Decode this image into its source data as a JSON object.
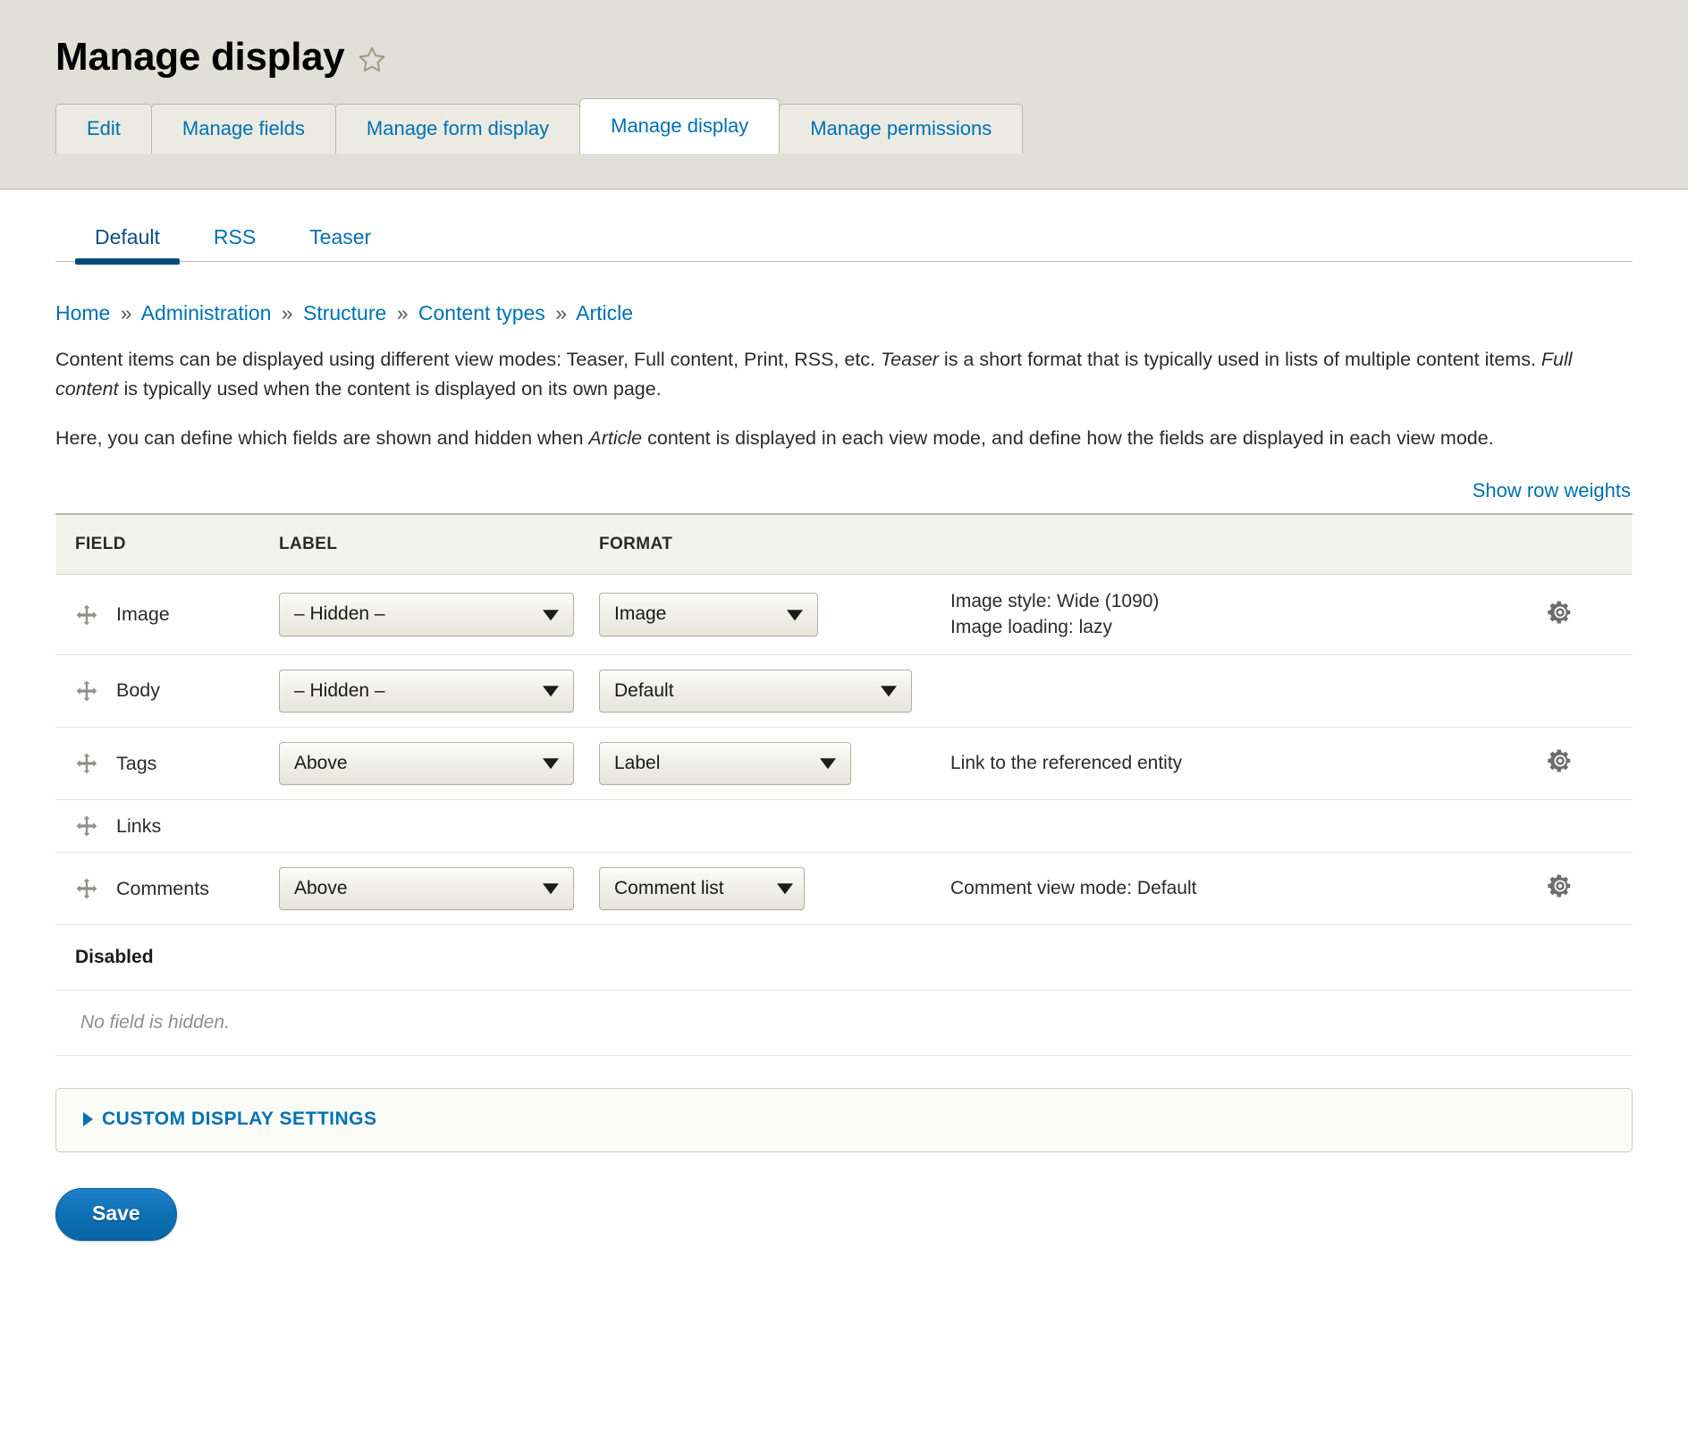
{
  "header": {
    "title": "Manage display",
    "star_icon": "star-outline-icon"
  },
  "primary_tabs": [
    {
      "label": "Edit",
      "active": false
    },
    {
      "label": "Manage fields",
      "active": false
    },
    {
      "label": "Manage form display",
      "active": false
    },
    {
      "label": "Manage display",
      "active": true
    },
    {
      "label": "Manage permissions",
      "active": false
    }
  ],
  "secondary_tabs": [
    {
      "label": "Default",
      "active": true
    },
    {
      "label": "RSS",
      "active": false
    },
    {
      "label": "Teaser",
      "active": false
    }
  ],
  "breadcrumb": {
    "separator": "»",
    "items": [
      "Home",
      "Administration",
      "Structure",
      "Content types",
      "Article"
    ]
  },
  "description": {
    "paragraph1_part1": "Content items can be displayed using different view modes: Teaser, Full content, Print, RSS, etc. ",
    "paragraph1_em1": "Teaser",
    "paragraph1_part2": " is a short format that is typically used in lists of multiple content items. ",
    "paragraph1_em2": "Full content",
    "paragraph1_part3": " is typically used when the content is displayed on its own page.",
    "paragraph2_part1": "Here, you can define which fields are shown and hidden when ",
    "paragraph2_em1": "Article",
    "paragraph2_part2": " content is displayed in each view mode, and define how the fields are displayed in each view mode."
  },
  "row_weights_link": "Show row weights",
  "table": {
    "headers": {
      "field": "FIELD",
      "label": "LABEL",
      "format": "FORMAT",
      "summary": "",
      "operations": ""
    },
    "rows": [
      {
        "field": "Image",
        "label_select": "– Hidden –",
        "format_select": "Image",
        "summary_lines": [
          "Image style: Wide (1090)",
          "Image loading: lazy"
        ],
        "has_settings": true
      },
      {
        "field": "Body",
        "label_select": "– Hidden –",
        "format_select": "Default",
        "summary_lines": [],
        "has_settings": false
      },
      {
        "field": "Tags",
        "label_select": "Above",
        "format_select": "Label",
        "summary_lines": [
          "Link to the referenced entity"
        ],
        "has_settings": true
      },
      {
        "field": "Links",
        "label_select": null,
        "format_select": null,
        "summary_lines": [],
        "has_settings": false
      },
      {
        "field": "Comments",
        "label_select": "Above",
        "format_select": "Comment list",
        "summary_lines": [
          "Comment view mode: Default"
        ],
        "has_settings": true
      }
    ],
    "disabled_region_label": "Disabled",
    "disabled_empty_message": "No field is hidden."
  },
  "custom_display_settings": {
    "summary_label": "CUSTOM DISPLAY SETTINGS"
  },
  "actions": {
    "save_label": "Save"
  },
  "colors": {
    "link_blue": "#0071b3",
    "active_tab_underline": "#004c77",
    "header_band": "#e0e0d8",
    "save_button": "#0d6fb3",
    "table_header_bg": "#f3f3ee"
  }
}
